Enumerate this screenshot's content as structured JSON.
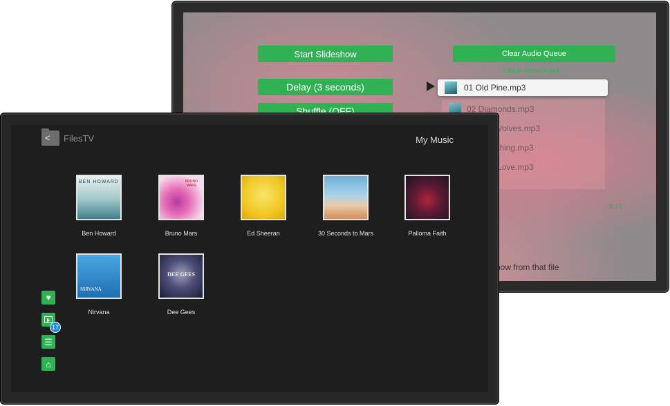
{
  "back_screen": {
    "buttons": {
      "start_slideshow": "Start Slideshow",
      "delay": "Delay (3 seconds)",
      "shuffle": "Shuffle (OFF)",
      "clear_queue": "Clear Audio Queue"
    },
    "queue_hint": "Click to remove a track",
    "queue": [
      {
        "label": "01 Old Pine.mp3",
        "active": true
      },
      {
        "label": "02 Diamonds.mp3"
      },
      {
        "label": "Volves.mp3"
      },
      {
        "label": "thing.mp3"
      },
      {
        "label": "Love.mp3"
      }
    ],
    "time": "-5:16",
    "slideshow_text": "how from that file"
  },
  "front_screen": {
    "app_name": "FilesTV",
    "page_title": "My Music",
    "albums": [
      {
        "artist": "Ben Howard",
        "cover_text": "BEN HOWARD"
      },
      {
        "artist": "Bruno Mars",
        "cover_text": "BRUNO MARS"
      },
      {
        "artist": "Ed Sheeran"
      },
      {
        "artist": "30 Seconds to Mars"
      },
      {
        "artist": "Palloma Faith"
      },
      {
        "artist": "Nirvana",
        "cover_text": "NIRVANA"
      },
      {
        "artist": "Dee Gees",
        "cover_text": "DEE GEES"
      }
    ],
    "sidebar": {
      "favorites_icon": "heart-icon",
      "playlist_icon": "play-queue-icon",
      "playlist_badge": "17",
      "queue_icon": "list-icon",
      "home_icon": "home-icon"
    },
    "accent_color": "#2fb154"
  }
}
